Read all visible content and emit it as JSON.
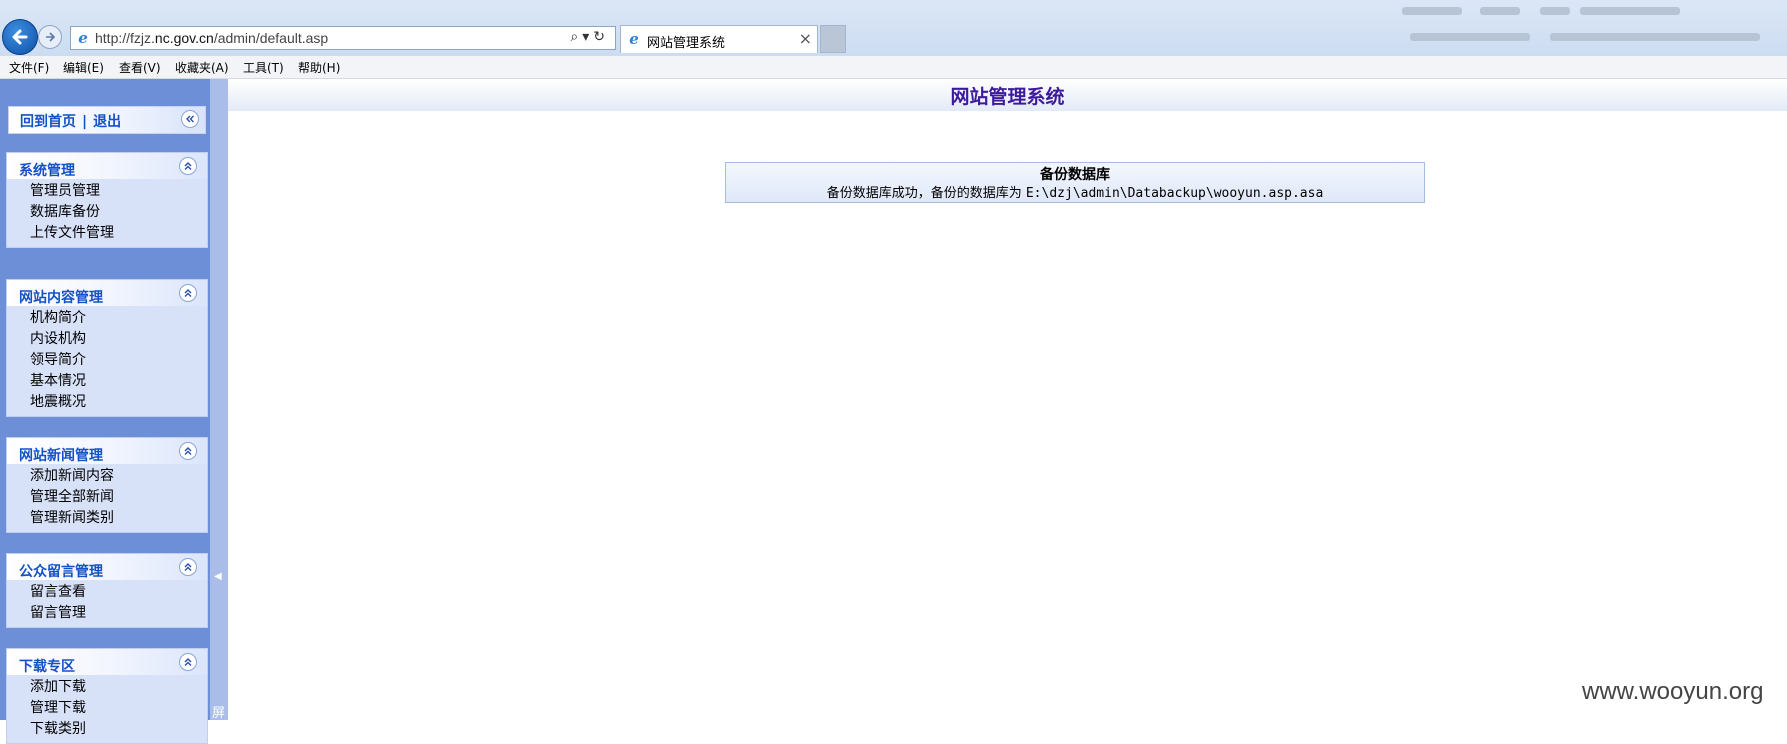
{
  "browser": {
    "url_prefix": "http://fzjz.",
    "url_host": "nc.gov.cn",
    "url_path": "/admin/default.asp",
    "tab_title": "网站管理系统",
    "menu": [
      "文件(F)",
      "编辑(E)",
      "查看(V)",
      "收藏夹(A)",
      "工具(T)",
      "帮助(H)"
    ]
  },
  "page": {
    "title": "网站管理系统",
    "top_links": {
      "home": "回到首页",
      "separator": "|",
      "logout": "退出"
    },
    "sections": [
      {
        "title": "系统管理",
        "items": [
          "管理员管理",
          "数据库备份",
          "上传文件管理"
        ]
      },
      {
        "title": "网站内容管理",
        "items": [
          "机构简介",
          "内设机构",
          "领导简介",
          "基本情况",
          "地震概况"
        ]
      },
      {
        "title": "网站新闻管理",
        "items": [
          "添加新闻内容",
          "管理全部新闻",
          "管理新闻类别"
        ]
      },
      {
        "title": "公众留言管理",
        "items": [
          "留言查看",
          "留言管理"
        ]
      },
      {
        "title": "下载专区",
        "items": [
          "添加下载",
          "管理下载",
          "下载类别"
        ]
      }
    ],
    "screen_label": "屏",
    "message": {
      "title": "备份数据库",
      "text": "备份数据库成功，备份的数据库为",
      "path": "E:\\dzj\\admin\\Databackup\\wooyun.asp.asa"
    }
  },
  "watermark": "www.wooyun.org"
}
